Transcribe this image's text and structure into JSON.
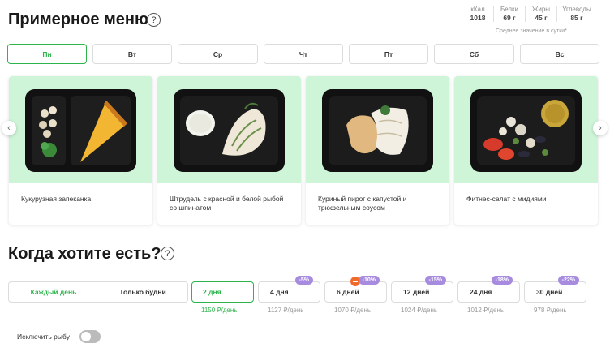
{
  "menu": {
    "title": "Примерное меню",
    "help_icon": "question-circle-icon",
    "nutrition": [
      {
        "label": "кКал",
        "value": "1018"
      },
      {
        "label": "Белки",
        "value": "69 г"
      },
      {
        "label": "Жиры",
        "value": "45 г"
      },
      {
        "label": "Углеводы",
        "value": "85 г"
      }
    ],
    "average_note": "Среднее значение в сутки*",
    "days": [
      "Пн",
      "Вт",
      "Ср",
      "Чт",
      "Пт",
      "Сб",
      "Вс"
    ],
    "active_day": "Пн",
    "dishes": [
      {
        "name": "Кукурузная запеканка"
      },
      {
        "name": "Штрудель с красной и белой рыбой со шпинатом"
      },
      {
        "name": "Куриный пирог с капустой и трюфельным соусом"
      },
      {
        "name": "Фитнес-салат с мидиями"
      }
    ],
    "prev_icon": "chevron-left-icon",
    "next_icon": "chevron-right-icon"
  },
  "schedule": {
    "title": "Когда хотите есть?",
    "options": [
      "Каждый день",
      "Только будни"
    ],
    "active_option": "Каждый день",
    "durations": [
      {
        "label": "2 дня",
        "badge": "",
        "price": "1150 ₽/день",
        "active": true
      },
      {
        "label": "4 дня",
        "badge": "-5%",
        "price": "1127 ₽/день"
      },
      {
        "label": "6 дней",
        "badge": "-10%",
        "price": "1070 ₽/день",
        "extra_icon": "no-entry-icon"
      },
      {
        "label": "12 дней",
        "badge": "-15%",
        "price": "1024 ₽/день"
      },
      {
        "label": "24 дня",
        "badge": "-18%",
        "price": "1012 ₽/день"
      },
      {
        "label": "30 дней",
        "badge": "-22%",
        "price": "978 ₽/день"
      }
    ],
    "exclude_fish_label": "Исключить рыбу",
    "exclude_fish_enabled": false
  },
  "colors": {
    "accent": "#2db44a",
    "badge": "#a78bdf",
    "card_bg": "#cef5d8",
    "no_entry": "#f06a2c"
  }
}
